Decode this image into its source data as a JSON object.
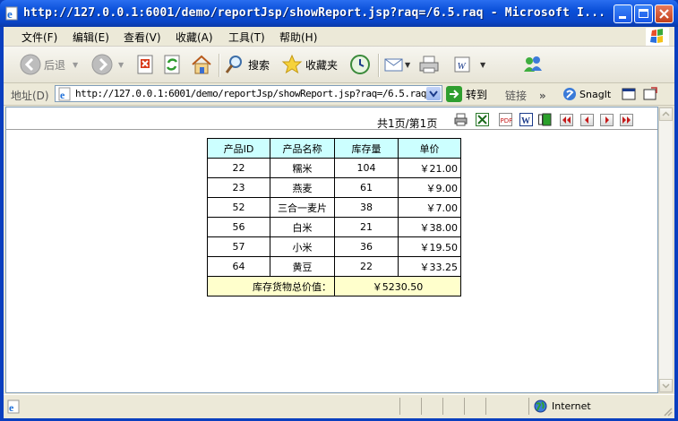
{
  "window": {
    "title": "http://127.0.0.1:6001/demo/reportJsp/showReport.jsp?raq=/6.5.raq - Microsoft I..."
  },
  "menu": [
    "文件(F)",
    "编辑(E)",
    "查看(V)",
    "收藏(A)",
    "工具(T)",
    "帮助(H)"
  ],
  "toolbar": {
    "back": "后退",
    "search": "搜索",
    "favorites": "收藏夹"
  },
  "address": {
    "label": "地址(D)",
    "url": "http://127.0.0.1:6001/demo/reportJsp/showReport.jsp?raq=/6.5.raq",
    "go": "转到",
    "links": "链接",
    "snagit": "SnagIt"
  },
  "report": {
    "page_info": "共1页/第1页",
    "headers": [
      "产品ID",
      "产品名称",
      "库存量",
      "单价"
    ],
    "rows": [
      [
        "22",
        "糯米",
        "104",
        "￥21.00"
      ],
      [
        "23",
        "燕麦",
        "61",
        "￥9.00"
      ],
      [
        "52",
        "三合一麦片",
        "38",
        "￥7.00"
      ],
      [
        "56",
        "白米",
        "21",
        "￥38.00"
      ],
      [
        "57",
        "小米",
        "36",
        "￥19.50"
      ],
      [
        "64",
        "黄豆",
        "22",
        "￥33.25"
      ]
    ],
    "total_label": "库存货物总价值：",
    "total_value": "￥5230.50"
  },
  "status": {
    "zone": "Internet"
  },
  "icons": {
    "ie": "ie-page-icon",
    "back": "back-arrow-icon",
    "forward": "forward-arrow-icon",
    "stop": "stop-icon",
    "refresh": "refresh-icon",
    "home": "home-icon",
    "search": "search-icon",
    "favorites": "star-icon",
    "history": "history-icon",
    "mail": "mail-icon",
    "print": "printer-icon",
    "edit": "word-icon",
    "messenger": "messenger-icon",
    "go": "go-arrow-icon"
  }
}
